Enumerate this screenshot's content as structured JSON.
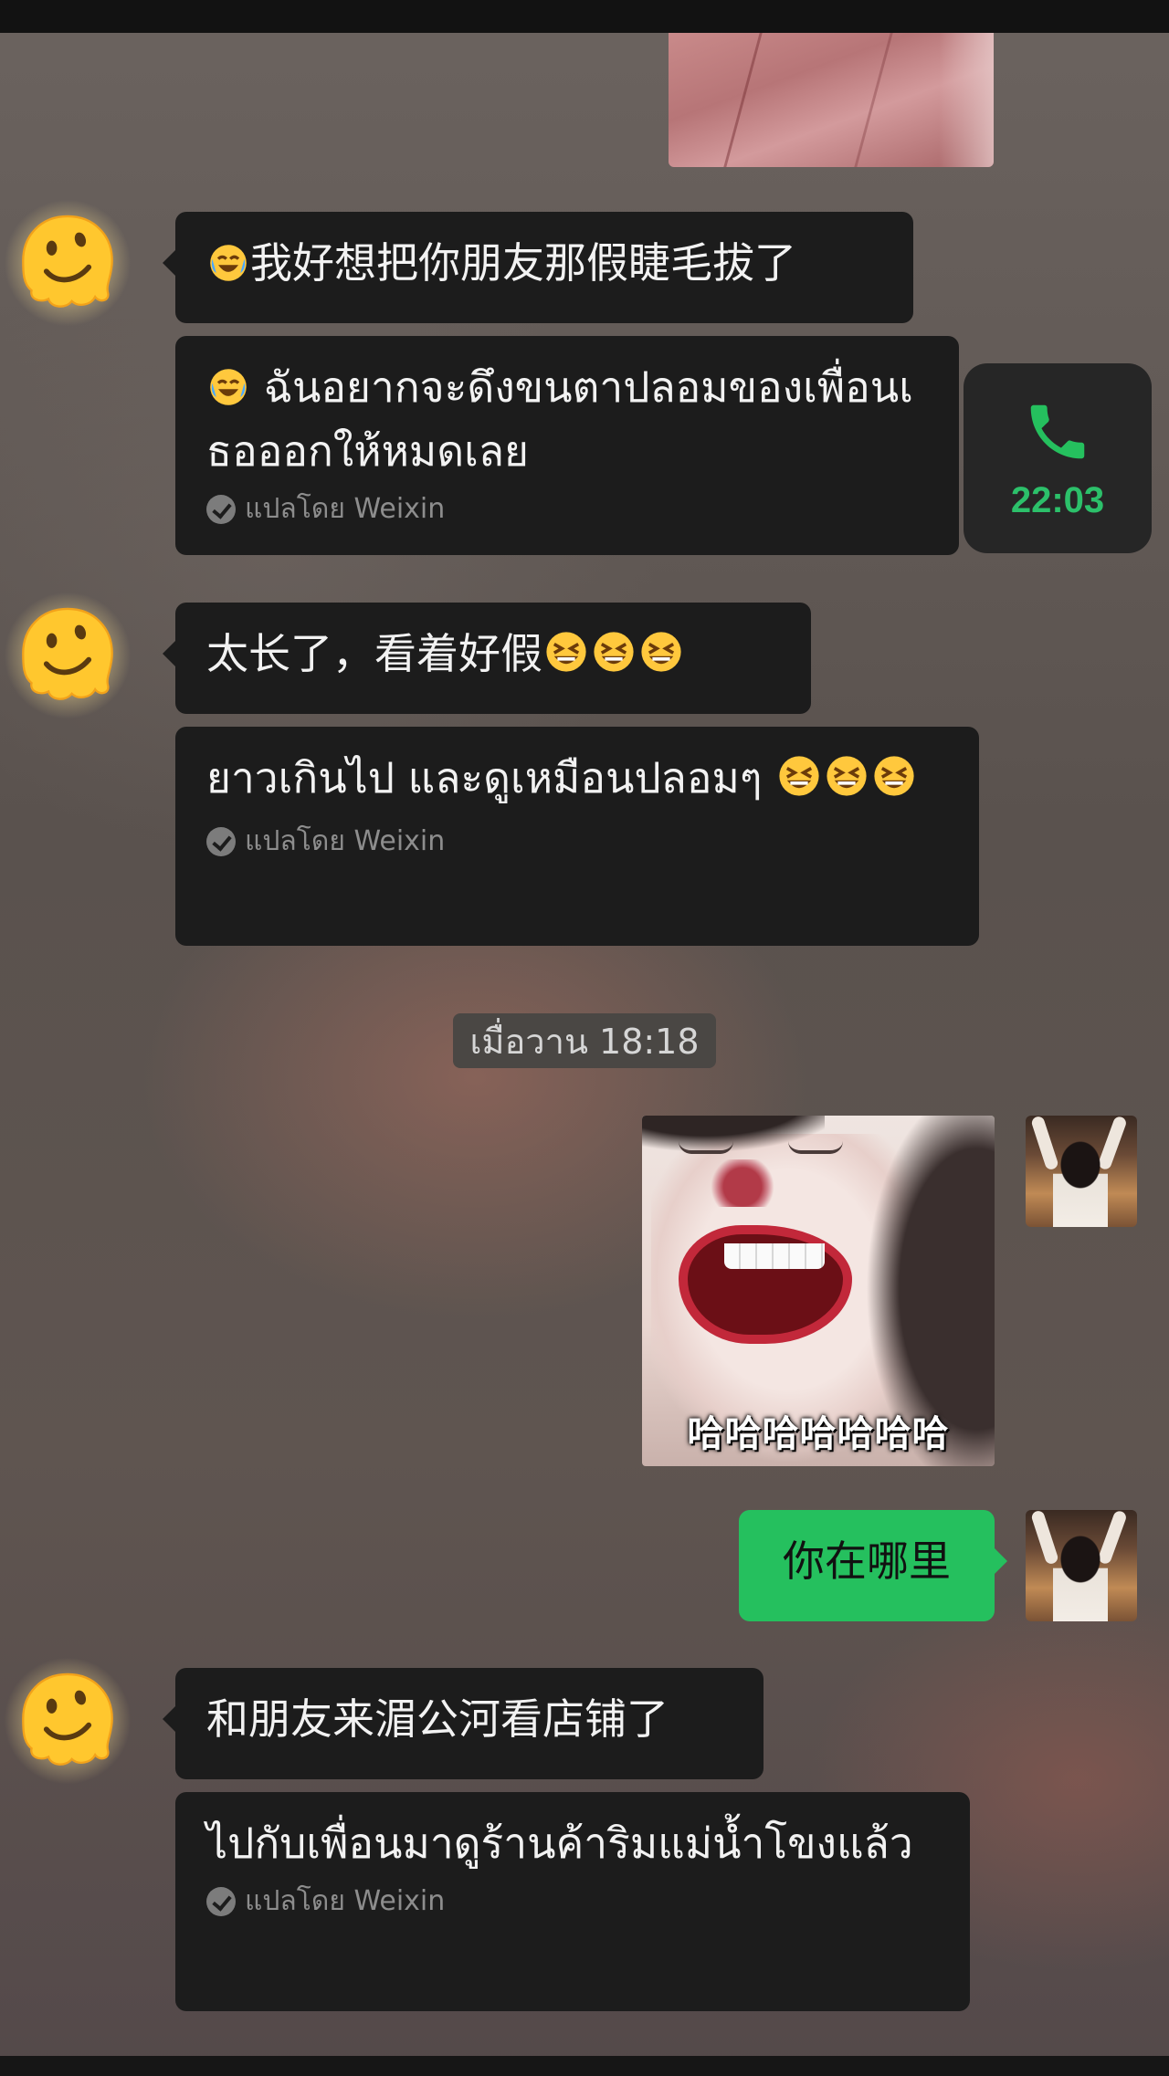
{
  "colors": {
    "bubble_dark": "#1c1c1c",
    "bubble_green": "#25c05e",
    "call_accent": "#2cc06a",
    "muted_text": "#8d8d8d"
  },
  "messages": [
    {
      "sender": "friend",
      "original": "我好想把你朋友那假睫毛拔了",
      "original_emoji": "face-with-tears-of-joy",
      "translation": "ฉันอยากจะดึงขนตาปลอมของเพื่อนเธอออกให้หมดเลย",
      "translation_emoji": "face-with-tears-of-joy",
      "translated_by": "แปลโดย Weixin"
    },
    {
      "sender": "friend",
      "original": "太长了，看着好假",
      "original_emoji_count": 3,
      "translation": "ยาวเกินไป และดูเหมือนปลอมๆ ",
      "translation_emoji_count": 3,
      "translated_by": "แปลโดย Weixin"
    },
    {
      "sender": "me",
      "type": "sticker",
      "caption": "哈哈哈哈哈哈哈"
    },
    {
      "sender": "me",
      "text": "你在哪里"
    },
    {
      "sender": "friend",
      "original": "和朋友来湄公河看店铺了",
      "translation": "ไปกับเพื่อนมาดูร้านค้าริมแม่น้ำโขงแล้ว",
      "translated_by": "แปลโดย Weixin"
    }
  ],
  "call": {
    "icon": "phone-icon",
    "time": "22:03"
  },
  "timestamp": "เมื่อวาน 18:18"
}
